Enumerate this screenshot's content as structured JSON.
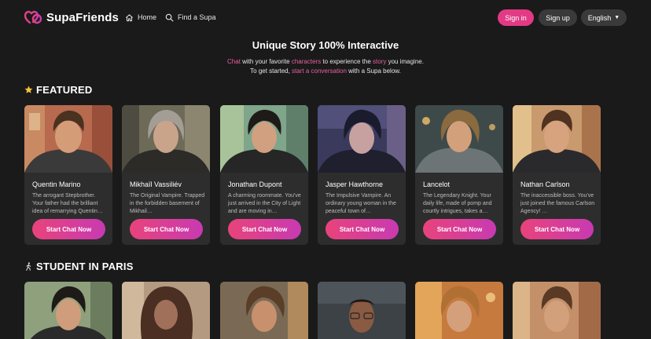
{
  "brand": {
    "name": "SupaFriends",
    "accent": "#e23a85"
  },
  "nav": [
    {
      "label": "Home",
      "icon": "home-icon"
    },
    {
      "label": "Find a Supa",
      "icon": "search-icon"
    }
  ],
  "auth": {
    "signin": "Sign in",
    "signup": "Sign up"
  },
  "language": {
    "selected": "English"
  },
  "hero": {
    "title": "Unique Story 100% Interactive",
    "line1": {
      "w1": "Chat",
      "t1": " with your favorite ",
      "w2": "characters",
      "t2": " to experience the ",
      "w3": "story",
      "t3": " you imagine."
    },
    "line2": {
      "t1": "To get started, ",
      "w1": "start a conversation",
      "t2": " with a Supa below."
    }
  },
  "sections": {
    "featured": {
      "title": "FEATURED",
      "icon": "star-icon"
    },
    "student": {
      "title": "STUDENT IN PARIS",
      "icon": "walking-person-icon"
    }
  },
  "featured": [
    {
      "name": "Quentin Marino",
      "desc": "The arrogant Stepbrother. Your father had the brilliant idea of remarrying Quentin…",
      "cta": "Start Chat Now"
    },
    {
      "name": "Mikhaïl Vassiliév",
      "desc": "The Original Vampire. Trapped in the forbidden basement of Mikhail…",
      "cta": "Start Chat Now"
    },
    {
      "name": "Jonathan Dupont",
      "desc": "A charming roommate. You've just arrived in the City of Light and are moving in…",
      "cta": "Start Chat Now"
    },
    {
      "name": "Jasper Hawthorne",
      "desc": "The Impulsive Vampire. An ordinary young woman in the peaceful town of…",
      "cta": "Start Chat Now"
    },
    {
      "name": "Lancelot",
      "desc": "The Legendary Knight. Your daily life, made of pomp and courtly intrigues, takes a…",
      "cta": "Start Chat Now"
    },
    {
      "name": "Nathan Carlson",
      "desc": "The inaccessible boss. You've just joined the famous Carlson Agency! …",
      "cta": "Start Chat Now"
    }
  ]
}
